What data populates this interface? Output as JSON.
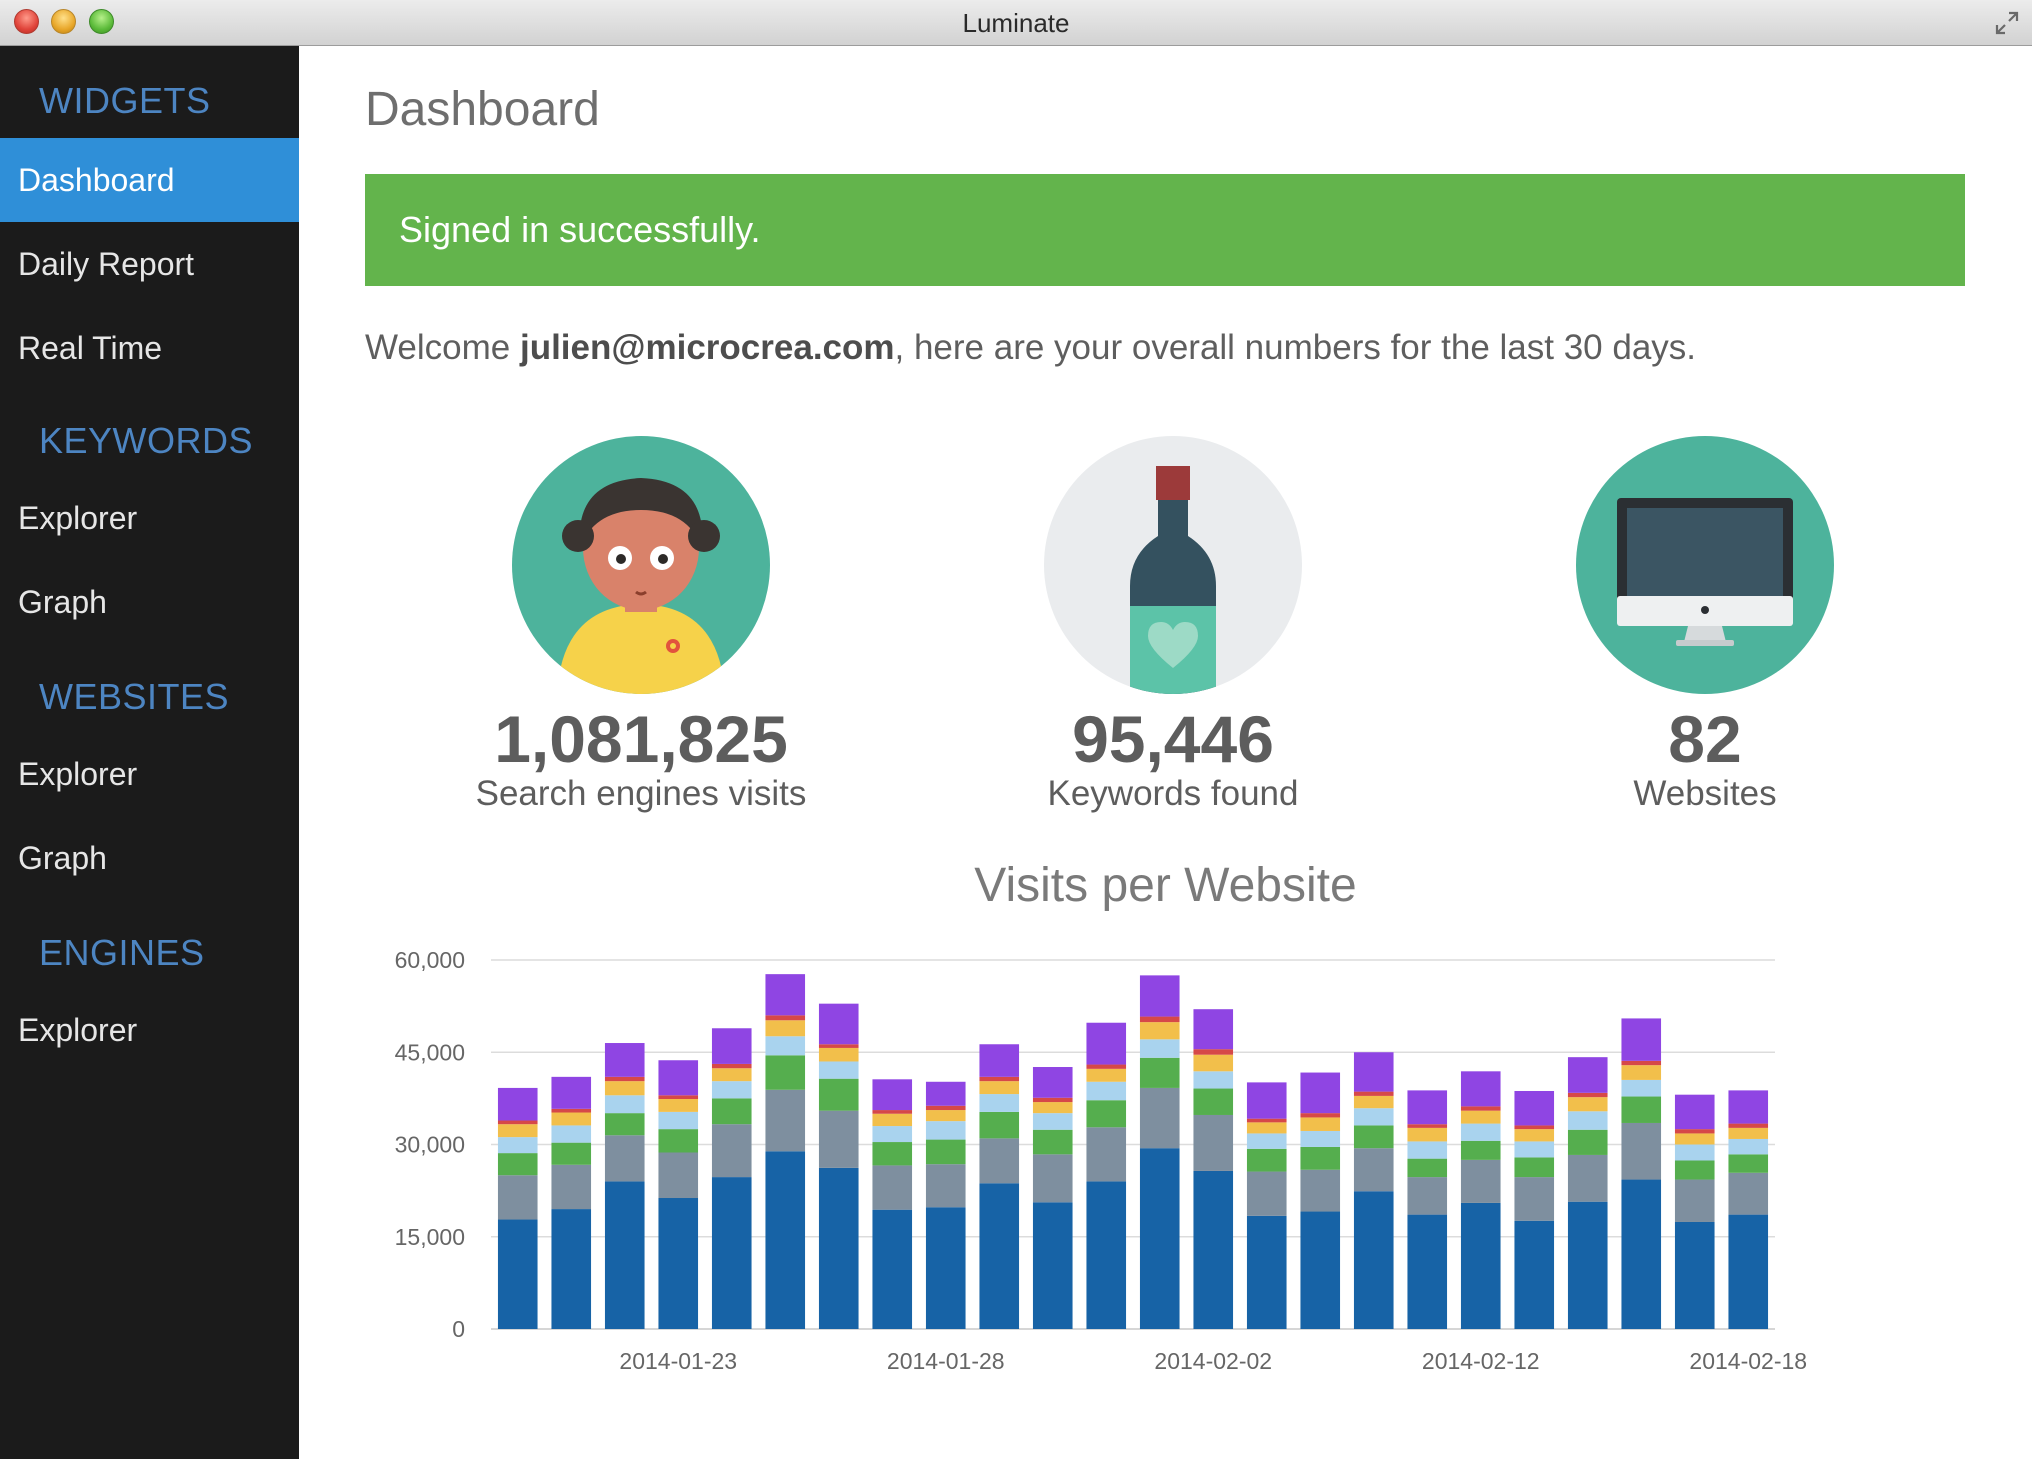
{
  "window": {
    "title": "Luminate"
  },
  "sidebar": {
    "sections": [
      {
        "heading": "WIDGETS",
        "items": [
          "Dashboard",
          "Daily Report",
          "Real Time"
        ]
      },
      {
        "heading": "KEYWORDS",
        "items": [
          "Explorer",
          "Graph"
        ]
      },
      {
        "heading": "WEBSITES",
        "items": [
          "Explorer",
          "Graph"
        ]
      },
      {
        "heading": "ENGINES",
        "items": [
          "Explorer"
        ]
      }
    ],
    "active_item": "Dashboard"
  },
  "main": {
    "title": "Dashboard",
    "alert": "Signed in successfully.",
    "welcome": {
      "prefix": "Welcome ",
      "email": "julien@microcrea.com",
      "suffix": ", here are your overall numbers for the last 30 days."
    },
    "stats": [
      {
        "value": "1,081,825",
        "label": "Search engines visits",
        "icon": "person-icon"
      },
      {
        "value": "95,446",
        "label": "Keywords found",
        "icon": "wine-bottle-icon"
      },
      {
        "value": "82",
        "label": "Websites",
        "icon": "computer-monitor-icon"
      }
    ]
  },
  "colors": {
    "sidebar_bg": "#1b1b1b",
    "sidebar_heading": "#4d85c2",
    "active_item": "#2f8fd8",
    "alert_bg": "#63b44c",
    "teal": "#4db39c"
  },
  "chart_data": {
    "type": "bar",
    "stacked": true,
    "title": "Visits per Website",
    "ylim": [
      0,
      60000
    ],
    "y_ticks": [
      "0",
      "15,000",
      "30,000",
      "45,000",
      "60,000"
    ],
    "x_tick_labels": [
      "2014-01-23",
      "2014-01-28",
      "2014-02-02",
      "2014-02-12",
      "2014-02-18"
    ],
    "grid": true,
    "legend": "none",
    "series_colors": [
      "#1763a6",
      "#7e8f9f",
      "#55ae4e",
      "#a9d3ee",
      "#f2bf4b",
      "#d64848",
      "#8f45e3"
    ],
    "stacks": [
      [
        17800,
        7200,
        3600,
        2600,
        2100,
        600,
        5300
      ],
      [
        19500,
        7200,
        3600,
        2800,
        2100,
        600,
        5200
      ],
      [
        24000,
        7500,
        3600,
        2900,
        2300,
        700,
        5500
      ],
      [
        21300,
        7400,
        3800,
        2800,
        2100,
        600,
        5700
      ],
      [
        24700,
        8600,
        4200,
        2800,
        2100,
        700,
        5800
      ],
      [
        28900,
        10000,
        5600,
        3100,
        2600,
        800,
        6700
      ],
      [
        26200,
        9300,
        5200,
        2800,
        2200,
        600,
        6600
      ],
      [
        19400,
        7200,
        3800,
        2600,
        2000,
        600,
        5000
      ],
      [
        19800,
        7000,
        4000,
        3000,
        1800,
        700,
        3900
      ],
      [
        23700,
        7300,
        4300,
        2900,
        2100,
        700,
        5300
      ],
      [
        20600,
        7800,
        4000,
        2700,
        1800,
        700,
        5000
      ],
      [
        24000,
        8800,
        4400,
        3000,
        2100,
        700,
        6800
      ],
      [
        29400,
        9800,
        4900,
        3000,
        2800,
        900,
        6700
      ],
      [
        25700,
        9100,
        4300,
        2800,
        2700,
        900,
        6500
      ],
      [
        18400,
        7200,
        3700,
        2500,
        1800,
        600,
        5900
      ],
      [
        19100,
        6800,
        3700,
        2600,
        2200,
        700,
        6600
      ],
      [
        22400,
        7000,
        3700,
        2800,
        2000,
        700,
        6400
      ],
      [
        18600,
        6100,
        3000,
        2800,
        2200,
        600,
        5500
      ],
      [
        20500,
        7000,
        3100,
        2800,
        2100,
        700,
        5700
      ],
      [
        17600,
        7100,
        3200,
        2600,
        2000,
        600,
        5600
      ],
      [
        20700,
        7600,
        4100,
        3000,
        2300,
        700,
        5800
      ],
      [
        24300,
        9200,
        4300,
        2700,
        2400,
        700,
        6900
      ],
      [
        17400,
        6900,
        3100,
        2600,
        1800,
        700,
        5600
      ],
      [
        18600,
        6800,
        3000,
        2500,
        1800,
        700,
        5400
      ]
    ]
  }
}
